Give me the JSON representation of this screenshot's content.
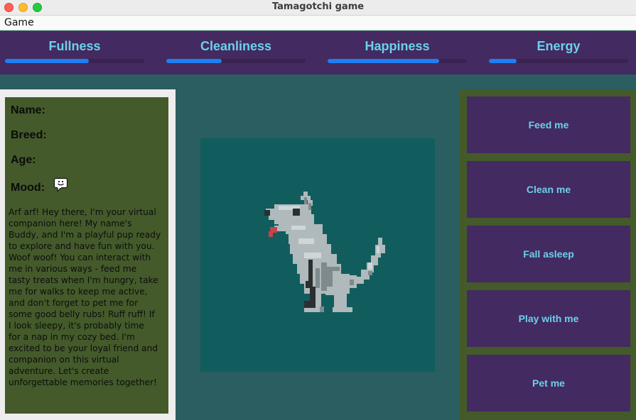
{
  "window": {
    "title": "Tamagotchi game"
  },
  "menu": {
    "game": "Game"
  },
  "stats": [
    {
      "label": "Fullness",
      "level": 0.6
    },
    {
      "label": "Cleanliness",
      "level": 0.4
    },
    {
      "label": "Happiness",
      "level": 0.8
    },
    {
      "label": "Energy",
      "level": 0.2
    }
  ],
  "info": {
    "name_label": "Name:",
    "breed_label": "Breed:",
    "age_label": "Age:",
    "mood_label": "Mood:",
    "mood_icon": "happy-speech-bubble-icon",
    "bio_lines": [
      "Arf arf! Hey there, I'm your virtual",
      "companion here! My name's",
      "Buddy, and I'm a playful pup ready",
      "to explore and have fun with you.",
      "Woof woof! You can interact with",
      "me in various ways - feed me",
      "tasty treats when I'm hungry, take",
      "me for walks to keep me active,",
      "and don't forget to pet me for",
      "some good belly rubs! Ruff ruff! If",
      "I look sleepy, it's probably time",
      "for a nap in my cozy bed. I'm",
      "excited to be your loyal friend and",
      "companion on this virtual",
      "adventure. Let's create",
      "unforgettable memories together!"
    ]
  },
  "actions": [
    {
      "label": "Feed me"
    },
    {
      "label": "Clean me"
    },
    {
      "label": "Fall asleep"
    },
    {
      "label": "Play with me"
    },
    {
      "label": "Pet me"
    }
  ],
  "colors": {
    "stat_label": "#6ad1ec",
    "stat_fill": "#1f7ef4",
    "panel_purple": "#432a60",
    "panel_green": "#445a2a",
    "background": "#2b5e61",
    "pet_bg": "#115d5e"
  },
  "pet": {
    "icon": "pixel-wolf-dog-sprite"
  }
}
